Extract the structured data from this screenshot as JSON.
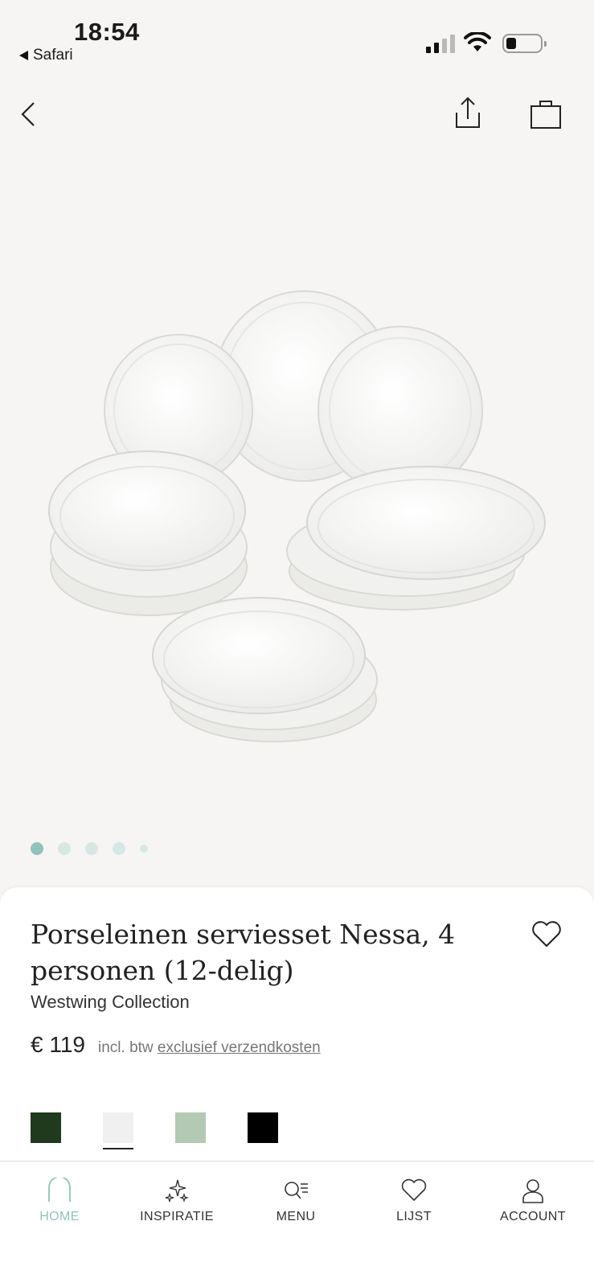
{
  "status_bar": {
    "time": "18:54",
    "back_app": "Safari"
  },
  "carousel": {
    "total_dots": 5,
    "active_index": 0
  },
  "product": {
    "title": "Porseleinen serviesset Nessa, 4 personen (12-delig)",
    "brand": "Westwing Collection",
    "price": "€ 119",
    "vat_note": "incl. btw",
    "shipping_link": "exclusief verzendkosten"
  },
  "colors": {
    "accent": "#8fc3bb",
    "swatches": [
      "#1f3a1c",
      "#f0f0f0",
      "#b3c9b3",
      "#000000"
    ],
    "selected_swatch_index": 1
  },
  "tabbar": {
    "items": [
      {
        "label": "HOME",
        "icon": "home-icon",
        "active": true
      },
      {
        "label": "INSPIRATIE",
        "icon": "sparkle-icon",
        "active": false
      },
      {
        "label": "MENU",
        "icon": "search-menu-icon",
        "active": false
      },
      {
        "label": "LIJST",
        "icon": "heart-icon",
        "active": false
      },
      {
        "label": "ACCOUNT",
        "icon": "user-icon",
        "active": false
      }
    ]
  }
}
